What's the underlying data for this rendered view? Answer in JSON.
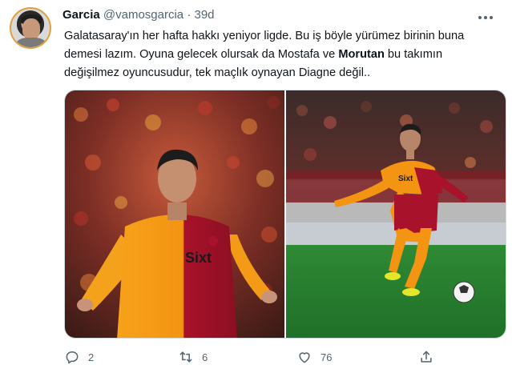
{
  "tweet": {
    "display_name": "Garcia",
    "handle": "@vamosgarcia",
    "separator": "·",
    "time": "39d",
    "text_part1": "Galatasaray'ın her hafta hakkı yeniyor ligde. Bu iş böyle yürümez birinin buna demesi lazım. Oyuna gelecek olursak da Mostafa ve ",
    "text_bold": "Morutan",
    "text_part2": " bu takımın değişilmez oyuncusudur, tek maçlık oynayan Diagne değil.."
  },
  "media": {
    "photos": [
      {
        "description_icon": "player-photo",
        "shirt_text": "Sixt"
      },
      {
        "description_icon": "player-photo",
        "shirt_text": "Sixt"
      }
    ]
  },
  "actions": {
    "reply_count": "2",
    "retweet_count": "6",
    "like_count": "76"
  },
  "colors": {
    "accent_orange": "#f39c12",
    "galatasaray_red": "#a8122a",
    "text_secondary": "#536471"
  }
}
